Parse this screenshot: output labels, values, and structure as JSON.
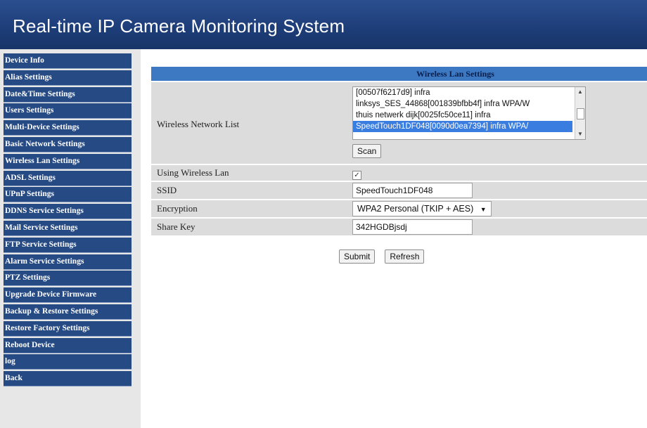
{
  "header": {
    "title": "Real-time IP Camera Monitoring System"
  },
  "sidebar": {
    "items": [
      {
        "label": "Device Info"
      },
      {
        "label": "Alias Settings"
      },
      {
        "label": "Date&Time Settings"
      },
      {
        "label": "Users Settings"
      },
      {
        "label": "Multi-Device Settings"
      },
      {
        "label": "Basic Network Settings"
      },
      {
        "label": "Wireless Lan Settings"
      },
      {
        "label": "ADSL Settings"
      },
      {
        "label": "UPnP Settings"
      },
      {
        "label": "DDNS Service Settings"
      },
      {
        "label": "Mail Service Settings"
      },
      {
        "label": "FTP Service Settings"
      },
      {
        "label": "Alarm Service Settings"
      },
      {
        "label": "PTZ Settings"
      },
      {
        "label": "Upgrade Device Firmware"
      },
      {
        "label": "Backup & Restore Settings"
      },
      {
        "label": "Restore Factory Settings"
      },
      {
        "label": "Reboot Device"
      },
      {
        "label": "log"
      },
      {
        "label": "Back"
      }
    ]
  },
  "panel": {
    "title": "Wireless Lan Settings",
    "network_list_label": "Wireless Network List",
    "networks": [
      {
        "text": "[00507f6217d9] infra",
        "selected": false
      },
      {
        "text": "linksys_SES_44868[001839bfbb4f] infra WPA/W",
        "selected": false
      },
      {
        "text": "thuis netwerk dijk[0025fc50ce11] infra",
        "selected": false
      },
      {
        "text": "SpeedTouch1DF048[0090d0ea7394] infra WPA/",
        "selected": true
      }
    ],
    "scan_label": "Scan",
    "using_wireless_label": "Using Wireless Lan",
    "using_wireless_checked": true,
    "ssid_label": "SSID",
    "ssid_value": "SpeedTouch1DF048",
    "encryption_label": "Encryption",
    "encryption_value": "WPA2 Personal (TKIP + AES)",
    "share_key_label": "Share Key",
    "share_key_value": "342HGDBjsdj",
    "submit_label": "Submit",
    "refresh_label": "Refresh"
  },
  "icons": {
    "dropdown": "chevron-down-icon",
    "scroll_up": "arrow-up-icon",
    "scroll_down": "arrow-down-icon",
    "check": "check-icon"
  },
  "colors": {
    "header_bg": "#1d3d78",
    "menu_bg": "#264a84",
    "title_bar": "#3d78c2",
    "row_bg": "#dcdcdc",
    "selection": "#3a7de0"
  }
}
